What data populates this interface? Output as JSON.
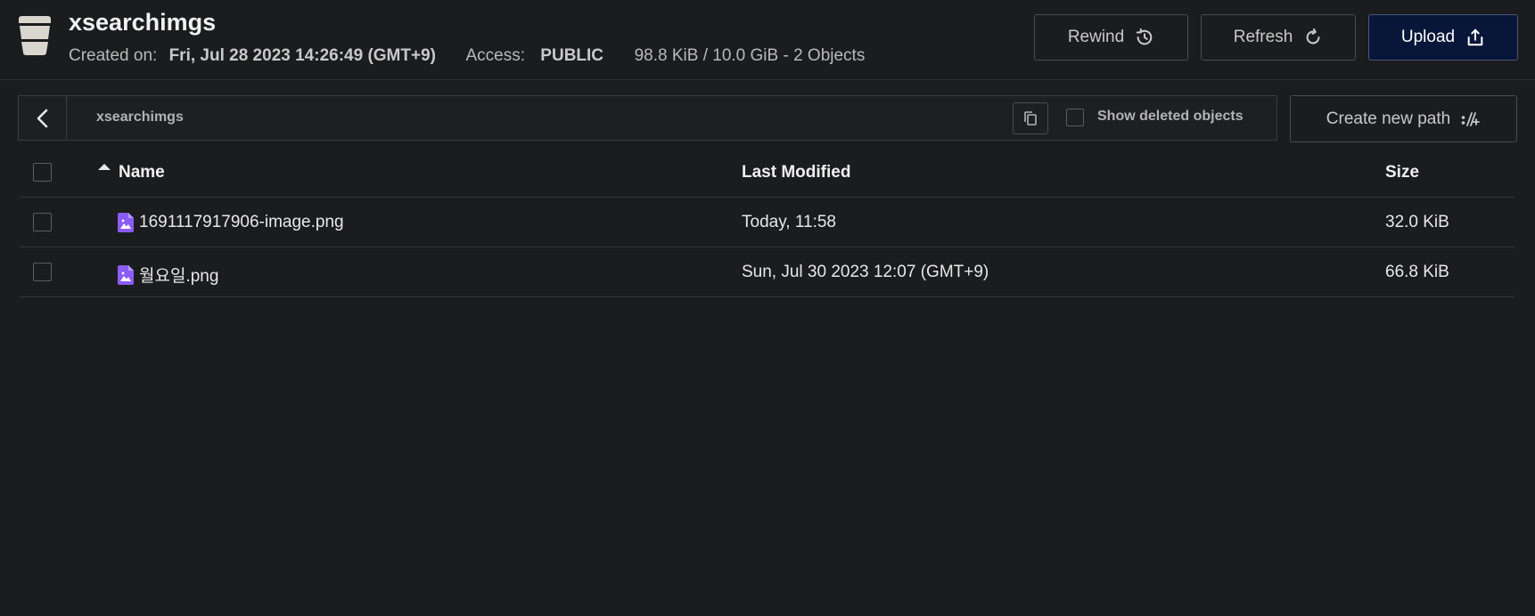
{
  "header": {
    "title": "xsearchimgs",
    "created_label": "Created on:",
    "created_value": "Fri, Jul 28 2023 14:26:49 (GMT+9)",
    "access_label": "Access:",
    "access_value": "PUBLIC",
    "usage": "98.8 KiB / 10.0 GiB - 2 Objects",
    "buttons": {
      "rewind": "Rewind",
      "refresh": "Refresh",
      "upload": "Upload"
    }
  },
  "pathbar": {
    "path": "xsearchimgs",
    "show_deleted_label": "Show deleted objects"
  },
  "create_path_label": "Create new path",
  "table": {
    "columns": {
      "name": "Name",
      "modified": "Last Modified",
      "size": "Size"
    },
    "rows": [
      {
        "name": "1691117917906-image.png",
        "modified": "Today, 11:58",
        "size": "32.0 KiB"
      },
      {
        "name": "월요일.png",
        "modified": "Sun, Jul 30 2023 12:07 (GMT+9)",
        "size": "66.8 KiB"
      }
    ]
  },
  "colors": {
    "background": "#1b1c1e",
    "upload_button": "#081639",
    "file_icon": "#8b5cf6"
  },
  "icons": {
    "bucket": "bucket-icon",
    "rewind": "history-icon",
    "refresh": "refresh-icon",
    "upload": "upload-icon",
    "back": "chevron-left-icon",
    "copy": "copy-icon",
    "new_path": "new-path-icon",
    "file": "image-file-icon",
    "sort": "sort-asc-icon"
  }
}
